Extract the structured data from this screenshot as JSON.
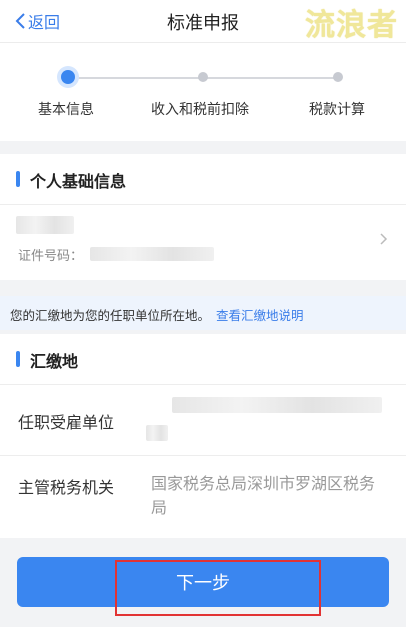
{
  "header": {
    "back_label": "返回",
    "title": "标准申报",
    "watermark": "流浪者"
  },
  "steps": [
    {
      "label": "基本信息",
      "active": true
    },
    {
      "label": "收入和税前扣除",
      "active": false
    },
    {
      "label": "税款计算",
      "active": false
    }
  ],
  "personal": {
    "title": "个人基础信息",
    "id_label": "证件号码："
  },
  "notice": {
    "text": "您的汇缴地为您的任职单位所在地。",
    "link": "查看汇缴地说明"
  },
  "location": {
    "title": "汇缴地",
    "employer_label": "任职受雇单位",
    "tax_office_label": "主管税务机关",
    "tax_office_value": "国家税务总局深圳市罗湖区税务局"
  },
  "footer": {
    "next_label": "下一步"
  },
  "colors": {
    "accent": "#3a86f0",
    "highlight_box": "#e23333"
  }
}
